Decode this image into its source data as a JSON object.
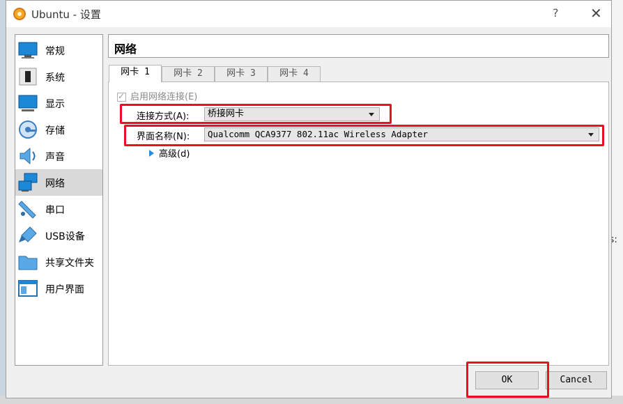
{
  "window": {
    "title": "Ubuntu - 设置",
    "help_glyph": "?",
    "close_glyph": "✕"
  },
  "sidebar": {
    "items": [
      {
        "label": "常规",
        "icon": "general-icon"
      },
      {
        "label": "系统",
        "icon": "system-icon"
      },
      {
        "label": "显示",
        "icon": "display-icon"
      },
      {
        "label": "存储",
        "icon": "storage-icon"
      },
      {
        "label": "声音",
        "icon": "audio-icon"
      },
      {
        "label": "网络",
        "icon": "network-icon",
        "selected": true
      },
      {
        "label": "串口",
        "icon": "serial-port-icon"
      },
      {
        "label": "USB设备",
        "icon": "usb-icon"
      },
      {
        "label": "共享文件夹",
        "icon": "shared-folder-icon"
      },
      {
        "label": "用户界面",
        "icon": "user-interface-icon"
      }
    ]
  },
  "panel": {
    "title": "网络",
    "tabs": [
      {
        "label": "网卡 1",
        "active": true
      },
      {
        "label": "网卡 2"
      },
      {
        "label": "网卡 3"
      },
      {
        "label": "网卡 4"
      }
    ],
    "enable_label": "启用网络连接(E)",
    "enable_checked": true,
    "attached_label": "连接方式(A):",
    "attached_value": "桥接网卡",
    "name_label": "界面名称(N):",
    "name_value": "Qualcomm QCA9377 802.11ac Wireless Adapter",
    "advanced_label": "高级(d)"
  },
  "buttons": {
    "ok": "OK",
    "cancel": "Cancel"
  },
  "background": {
    "right_fragment": "s:"
  },
  "colors": {
    "highlight": "#e81123",
    "accent": "#2d8ad8",
    "selected_bg": "#d9d9d9"
  }
}
